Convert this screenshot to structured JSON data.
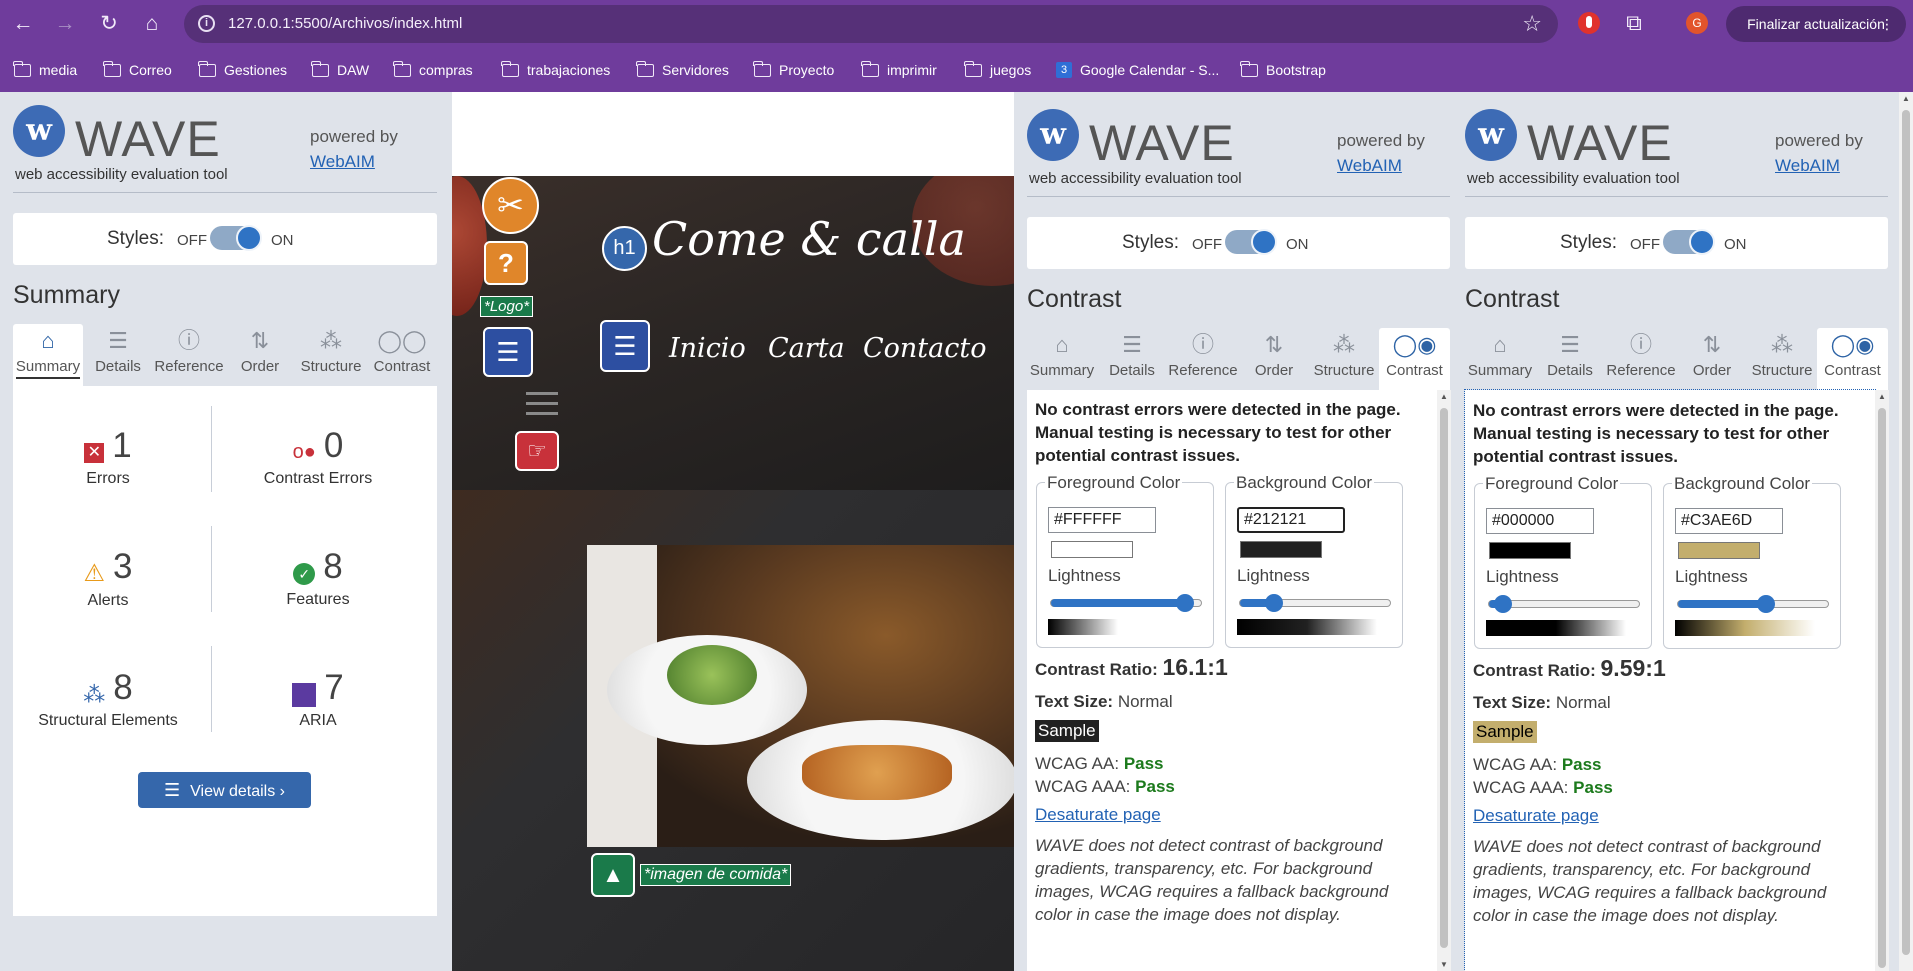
{
  "browser": {
    "nav": {
      "back": "←",
      "forward": "→",
      "reload": "↻",
      "home": "⌂"
    },
    "url": "127.0.0.1:5500/Archivos/index.html",
    "update_button": "Finalizar actualización",
    "avatar_letter": "G",
    "bookmarks": [
      "media",
      "Correo",
      "Gestiones",
      "DAW",
      "compras",
      "trabajaciones",
      "Servidores",
      "Proyecto",
      "imprimir",
      "juegos",
      "Google Calendar - S...",
      "Bootstrap"
    ]
  },
  "wave_common": {
    "title": "WAVE",
    "subtitle": "web accessibility evaluation tool",
    "powered_by": "powered by",
    "webaim": "WebAIM",
    "styles_label": "Styles:",
    "toggle_off": "OFF",
    "toggle_on": "ON",
    "tabs": [
      "Summary",
      "Details",
      "Reference",
      "Order",
      "Structure",
      "Contrast"
    ]
  },
  "summary_panel": {
    "section_title": "Summary",
    "stats": [
      {
        "value": "1",
        "label": "Errors",
        "icon": "error-icon"
      },
      {
        "value": "0",
        "label": "Contrast Errors",
        "icon": "contrast-error-icon"
      },
      {
        "value": "3",
        "label": "Alerts",
        "icon": "alert-icon"
      },
      {
        "value": "8",
        "label": "Features",
        "icon": "feature-icon"
      },
      {
        "value": "8",
        "label": "Structural Elements",
        "icon": "structure-icon"
      },
      {
        "value": "7",
        "label": "ARIA",
        "icon": "aria-icon"
      }
    ],
    "view_details": "View details ›"
  },
  "contrast_panels": [
    {
      "section_title": "Contrast",
      "message": "No contrast errors were detected in the page. Manual testing is necessary to test for other potential contrast issues.",
      "fg_legend": "Foreground Color",
      "bg_legend": "Background Color",
      "fg_value": "#FFFFFF",
      "bg_value": "#212121",
      "fg_lightness": 0.95,
      "bg_lightness": 0.19,
      "lightness_label": "Lightness",
      "ratio_label": "Contrast Ratio:",
      "ratio_value": "16.1:1",
      "text_size_label": "Text Size:",
      "text_size_value": "Normal",
      "sample": "Sample",
      "wcag_aa_label": "WCAG AA:",
      "wcag_aa_value": "Pass",
      "wcag_aaa_label": "WCAG AAA:",
      "wcag_aaa_value": "Pass",
      "desaturate": "Desaturate page",
      "note": "WAVE does not detect contrast of background gradients, transparency, etc. For background images, WCAG requires a fallback background color in case the image does not display."
    },
    {
      "section_title": "Contrast",
      "message": "No contrast errors were detected in the page. Manual testing is necessary to test for other potential contrast issues.",
      "fg_legend": "Foreground Color",
      "bg_legend": "Background Color",
      "fg_value": "#000000",
      "bg_value": "#C3AE6D",
      "fg_lightness": 0.04,
      "bg_lightness": 0.6,
      "lightness_label": "Lightness",
      "ratio_label": "Contrast Ratio:",
      "ratio_value": "9.59:1",
      "text_size_label": "Text Size:",
      "text_size_value": "Normal",
      "sample": "Sample",
      "wcag_aa_label": "WCAG AA:",
      "wcag_aa_value": "Pass",
      "wcag_aaa_label": "WCAG AAA:",
      "wcag_aaa_value": "Pass",
      "desaturate": "Desaturate page",
      "note": "WAVE does not detect contrast of background gradients, transparency, etc. For background images, WCAG requires a fallback background color in case the image does not display."
    }
  ],
  "page_preview": {
    "brand": "Come & calla",
    "h1_badge": "h1",
    "logo_label": "*Logo*",
    "nav": [
      "Inicio",
      "Carta",
      "Contacto"
    ],
    "image_label": "*imagen de comida*"
  }
}
